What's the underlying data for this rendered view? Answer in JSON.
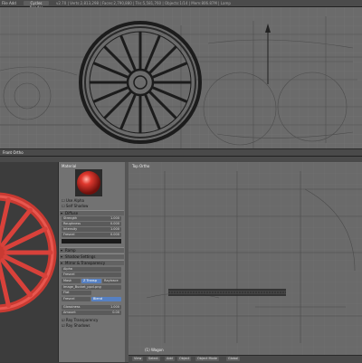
{
  "topbar": {
    "menus": [
      "File",
      "Add",
      "Render",
      "Help"
    ],
    "mode": "Cycles Render",
    "title": "v2.70 | Verts:2,813,298 | Faces:2,790,880 | Tris:5,581,760 | Objects:1/14 | Mem:806.87M | Lamp"
  },
  "viewport_top": {
    "view_label": "Front Ortho"
  },
  "viewport_bottom": {
    "view_label": "Top Ortho",
    "object_label": "(1) Wagon"
  },
  "properties": {
    "header": "Material",
    "checks": [
      "Use Alpha",
      "Self Shadow"
    ],
    "diffuse": {
      "label": "Diffuse",
      "fields": [
        {
          "label": "Strength",
          "value": "1.000"
        },
        {
          "label": "Roughness",
          "value": "0.000"
        },
        {
          "label": "Intensity",
          "value": "1.000"
        },
        {
          "label": "Fresnel",
          "value": "0.000"
        }
      ]
    },
    "sections": [
      "Ramp",
      "Shadow Settings",
      "Mirror & Transparency"
    ],
    "transparency": {
      "tabs": [
        "Mask",
        "Z Transp",
        "Raytrace"
      ],
      "fields": [
        "Alpha",
        "Fresnel"
      ],
      "image_field": "Image_Bucket_ppvl.png",
      "mapping": "Flat",
      "sub_tabs": [
        "Fresnel",
        "Blend"
      ]
    },
    "bottom": {
      "labels": [
        "Glossiness",
        "Amount"
      ],
      "values": [
        "1.000",
        "0.00"
      ],
      "toggles": [
        "Ray Transparency",
        "Ray Shadows"
      ]
    }
  },
  "bottombar": {
    "items": [
      "View",
      "Select",
      "Add",
      "Object",
      "Object Mode",
      "Global"
    ]
  },
  "colors": {
    "viewport": "#6a6a6a",
    "wheel_render": "#d8413a",
    "accent_blue": "#5680c2"
  }
}
